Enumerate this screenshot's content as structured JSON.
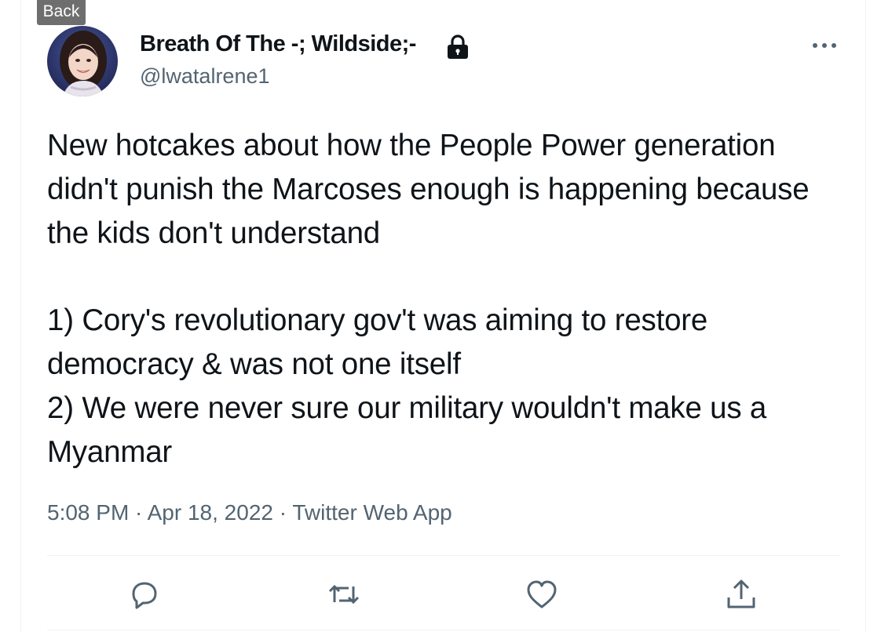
{
  "nav": {
    "back_label": "Back"
  },
  "tweet": {
    "author": {
      "display_name": "Breath Of The -; Wildside;- ",
      "handle": "@lwatalrene1",
      "protected_icon": "lock-icon",
      "avatar_icon": "profile-photo"
    },
    "more_icon": "more-horizontal-icon",
    "text": "New hotcakes about how the People Power generation didn't punish the Marcoses enough is happening because the kids don't understand\n\n1) Cory's revolutionary gov't was aiming to restore democracy & was not one itself\n2) We were never sure our military wouldn't make us a Myanmar",
    "time": "5:08 PM",
    "separator": " · ",
    "date": "Apr 18, 2022",
    "source": "Twitter Web App"
  },
  "actions": [
    {
      "name": "reply",
      "icon": "reply-icon"
    },
    {
      "name": "retweet",
      "icon": "retweet-icon"
    },
    {
      "name": "like",
      "icon": "heart-icon"
    },
    {
      "name": "share",
      "icon": "share-icon"
    }
  ],
  "colors": {
    "text_primary": "#0f1419",
    "text_secondary": "#536471",
    "divider": "#eff3f4",
    "back_button_bg": "#6e6e6e"
  }
}
